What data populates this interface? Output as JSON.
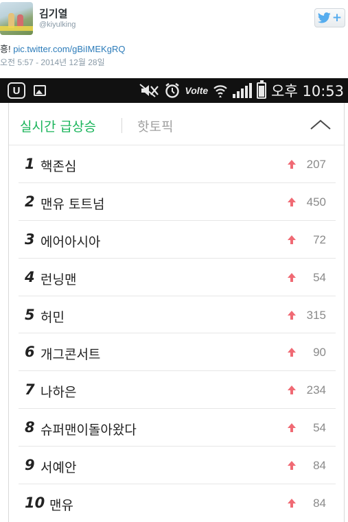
{
  "tweet": {
    "author_name": "김기열",
    "author_handle": "@kiyulking",
    "text_prefix": "흥! ",
    "link_text": "pic.twitter.com/gBiIMEKgRQ",
    "timestamp": "오전 5:57 - 2014년 12월 28일",
    "follow_icon": "twitter-bird-icon",
    "follow_plus": "+"
  },
  "status_bar": {
    "carrier_glyph": "U",
    "clock": "오후 10:53",
    "volte": "Volte",
    "icons": [
      "uplus-icon",
      "gallery-icon",
      "mute-icon",
      "alarm-icon",
      "volte-icon",
      "wifi-icon",
      "signal-icon",
      "battery-icon"
    ]
  },
  "trending": {
    "tab_active": "실시간 급상승",
    "tab_inactive": "핫토픽",
    "accent_color": "#19b45a",
    "arrow_color": "#f06a74",
    "items": [
      {
        "rank": "1",
        "term": "핵존심",
        "change": "207"
      },
      {
        "rank": "2",
        "term": "맨유 토트넘",
        "change": "450"
      },
      {
        "rank": "3",
        "term": "에어아시아",
        "change": "72"
      },
      {
        "rank": "4",
        "term": "런닝맨",
        "change": "54"
      },
      {
        "rank": "5",
        "term": "허민",
        "change": "315"
      },
      {
        "rank": "6",
        "term": "개그콘서트",
        "change": "90"
      },
      {
        "rank": "7",
        "term": "나하은",
        "change": "234"
      },
      {
        "rank": "8",
        "term": "슈퍼맨이돌아왔다",
        "change": "54"
      },
      {
        "rank": "9",
        "term": "서예안",
        "change": "84"
      },
      {
        "rank": "10",
        "term": "맨유",
        "change": "84"
      }
    ]
  }
}
